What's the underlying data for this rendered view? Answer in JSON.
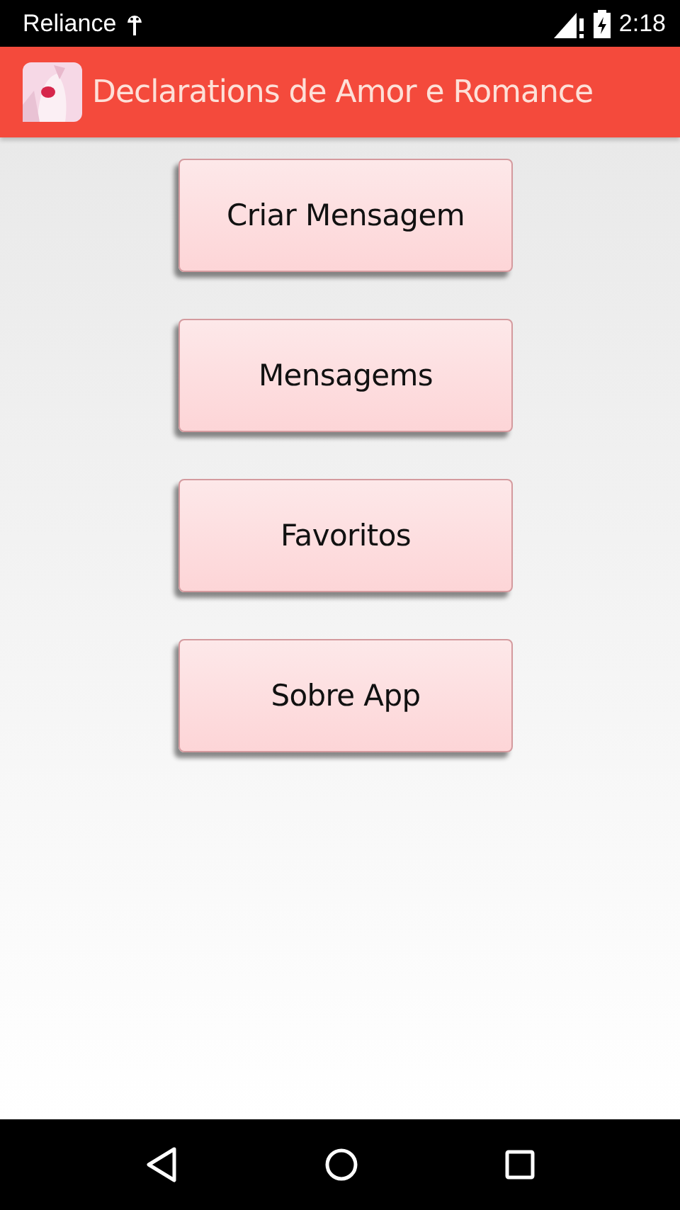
{
  "status_bar": {
    "carrier": "Reliance",
    "time": "2:18"
  },
  "app_bar": {
    "title": "Declarations de Amor e Romance"
  },
  "buttons": [
    "Criar Mensagem",
    "Mensagems",
    "Favoritos",
    "Sobre App"
  ]
}
